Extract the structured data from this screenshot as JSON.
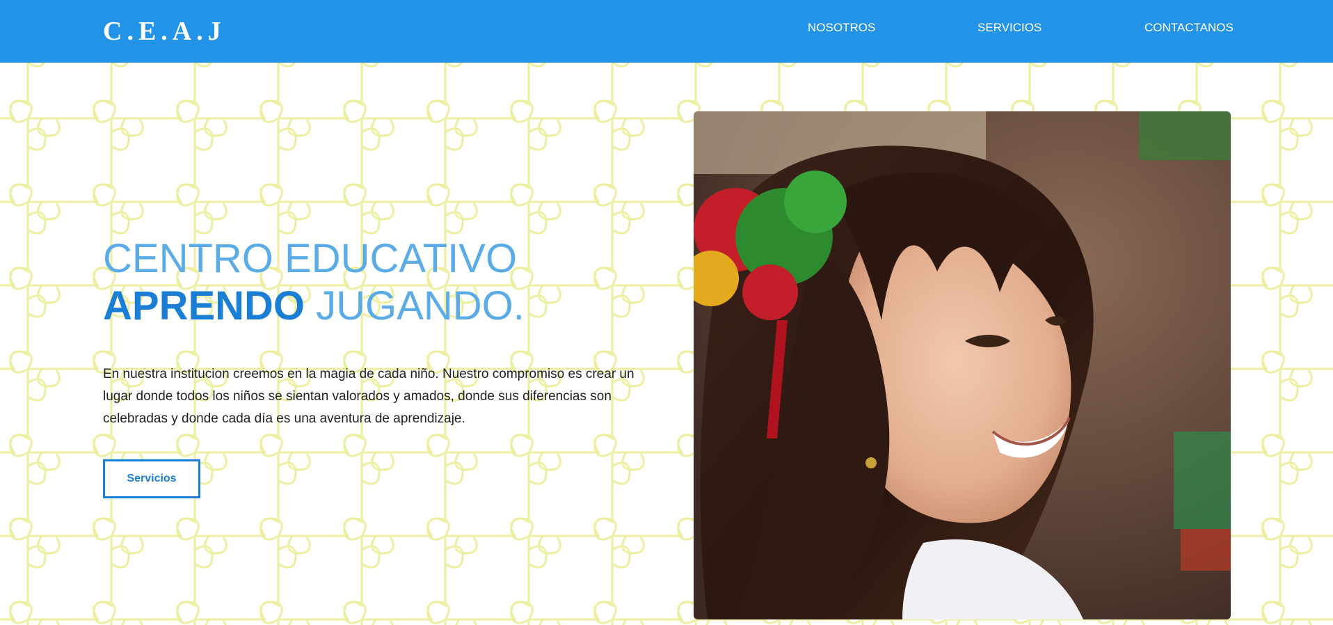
{
  "colors": {
    "header_bg": "#2393e8",
    "title_light": "#5aabe6",
    "title_strong": "#1a7fd4",
    "puzzle_line": "#eeeea0",
    "button_border": "#1a7fd4"
  },
  "header": {
    "logo": "C.E.A.J",
    "nav": [
      {
        "label": "NOSOTROS"
      },
      {
        "label": "SERVICIOS"
      },
      {
        "label": "CONTACTANOS"
      }
    ]
  },
  "hero": {
    "title_line1": "CENTRO EDUCATIVO",
    "title_strong": "APRENDO",
    "title_rest": " JUGANDO.",
    "description": "En nuestra institucion creemos en la magia de cada niño. Nuestro compromiso es crear un lugar donde todos los niños se sientan valorados y amados, donde sus diferencias son celebradas y donde cada día es una aventura de aprendizaje.",
    "button_label": "Servicios"
  },
  "icons": {
    "background": "puzzle-pattern-icon",
    "photo": "girl-photo-icon"
  }
}
